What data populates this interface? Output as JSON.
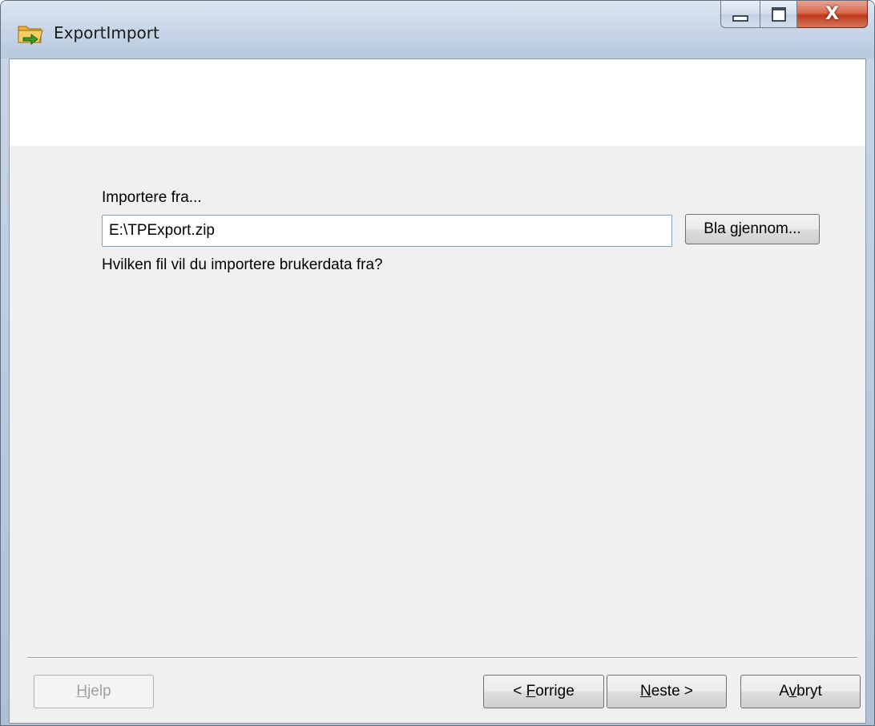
{
  "window": {
    "title": "ExportImport",
    "icon": "folder-arrow-icon"
  },
  "controls": {
    "minimize_icon": "minimize-icon",
    "maximize_icon": "maximize-icon",
    "close_icon": "close-icon",
    "close_glyph": "X",
    "close_color": "#c0391b"
  },
  "form": {
    "import_label": "Importere fra...",
    "path_value": "E:\\TPExport.zip",
    "browse_label": "Bla gjennom...",
    "hint": "Hvilken fil vil du importere brukerdata fra?"
  },
  "footer": {
    "help_label": "Hjelp",
    "help_hotkey": "H",
    "help_rest": "jelp",
    "back_prefix": "< ",
    "back_hotkey": "F",
    "back_rest": "orrige",
    "next_hotkey": "N",
    "next_rest": "este >",
    "cancel_pre": "A",
    "cancel_hotkey": "v",
    "cancel_rest": "bryt"
  }
}
